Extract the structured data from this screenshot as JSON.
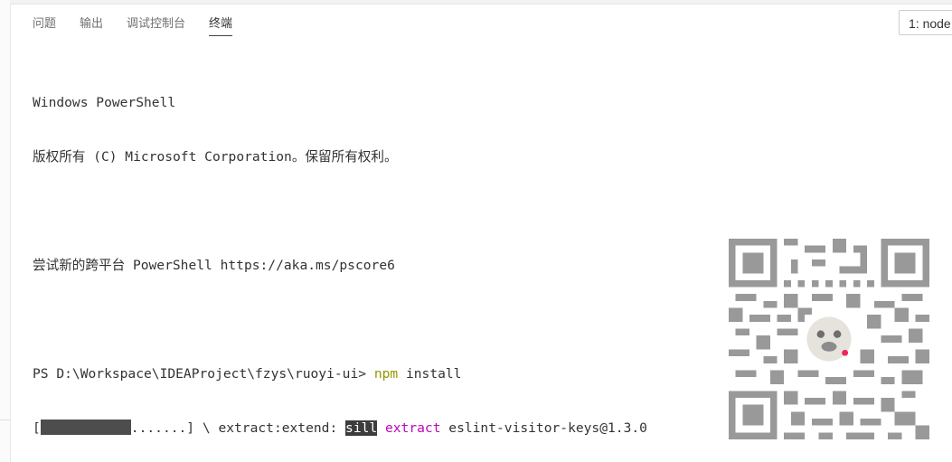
{
  "panel": {
    "tabs": [
      {
        "label": "问题"
      },
      {
        "label": "输出"
      },
      {
        "label": "调试控制台"
      },
      {
        "label": "终端"
      }
    ],
    "active_tab": "终端",
    "terminal_select": "1: node"
  },
  "terminal": {
    "line1": "Windows PowerShell",
    "line2": "版权所有 (C) Microsoft Corporation。保留所有权利。",
    "line3": "尝试新的跨平台 PowerShell https://aka.ms/pscore6",
    "prompt": "PS D:\\Workspace\\IDEAProject\\fzys\\ruoyi-ui> ",
    "cmd": "npm",
    "cmd_args": " install",
    "progress_open": "[",
    "progress_dots": ".......] \\ extract:extend: ",
    "log_level": "sill",
    "log_space": " ",
    "log_action": "extract",
    "log_pkg": " eslint-visitor-keys@1.3.0"
  },
  "colors": {
    "command": "#949800",
    "log_action": "#bc05bc",
    "highlight_bg": "#3c3c3c"
  },
  "icons": [
    "qr-code-icon"
  ]
}
